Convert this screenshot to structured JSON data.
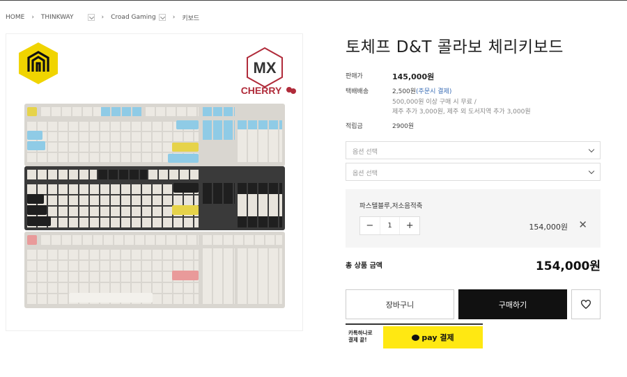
{
  "breadcrumb": {
    "home": "HOME",
    "level1": "THINKWAY",
    "level2": "Croad Gaming",
    "level3": "키보드"
  },
  "product": {
    "title": "토체프 D&T 콜라보 체리키보드",
    "image_brand_text": "MX",
    "image_brand_name": "CHERRY"
  },
  "info": {
    "sale_label": "판매가",
    "sale_price": "145,000원",
    "shipping_label": "택배배송",
    "shipping_fee": "2,500원",
    "shipping_method": "(주문시 결제)",
    "shipping_note1": "500,000원 이상 구매 시 무료 /",
    "shipping_note2": "제주 추가 3,000원, 제주 외 도서지역 추가 3,000원",
    "points_label": "적립금",
    "points_value": "2900원"
  },
  "options": {
    "select1_placeholder": "옵션 선택",
    "select2_placeholder": "옵션 선택",
    "selected_name": "파스텔블루,저소음적축",
    "quantity": "1",
    "minus": "−",
    "plus": "+",
    "selected_price": "154,000원",
    "remove": "✕"
  },
  "total": {
    "label": "총 상품 금액",
    "value": "154,000원"
  },
  "buttons": {
    "cart": "장바구니",
    "buy": "구매하기",
    "wish_icon": "heart-icon"
  },
  "kakaopay": {
    "note_line1": "카톡하나로",
    "note_line2": "결제 끝!",
    "button_label": "pay 결제"
  },
  "colors": {
    "blue_keys": "#8fcbe6",
    "yellow_keys": "#e6d34a",
    "pink_keys": "#e99a9a",
    "dark_keys": "#2a2a2a",
    "cream_keys": "#e8e4dc",
    "kakao_yellow": "#ffe812",
    "hex_logo_yellow": "#f0d400"
  }
}
